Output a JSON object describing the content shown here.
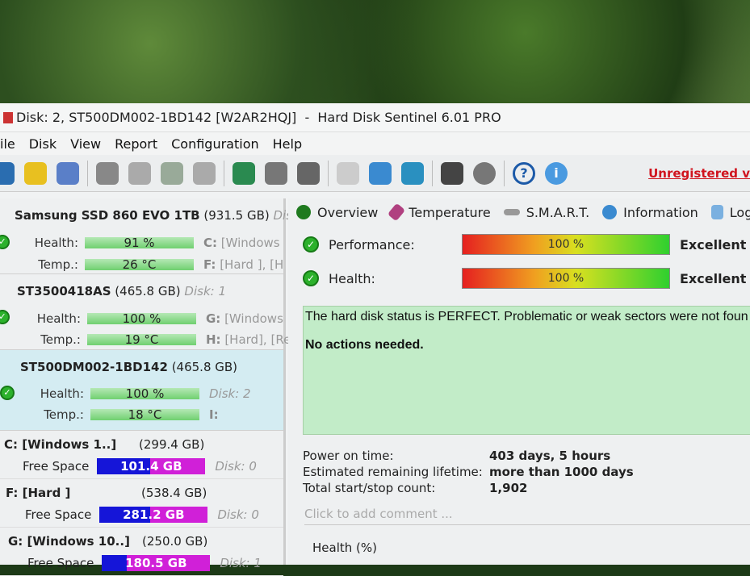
{
  "window": {
    "title": "Disk: 2, ST500DM002-1BD142 [W2AR2HQJ]  -  Hard Disk Sentinel 6.01 PRO"
  },
  "menu": [
    "ile",
    "Disk",
    "View",
    "Report",
    "Configuration",
    "Help"
  ],
  "toolbar": {
    "icons": [
      "refresh-icon",
      "alert-icon",
      "disk-icon",
      "disk-gray-icon",
      "disk-info-icon",
      "disk-check-icon",
      "disk-search-icon",
      "globe-disk-icon",
      "disk-stack-icon",
      "disk-tower-icon",
      "document-icon",
      "sync-icon",
      "network-icon",
      "laptop-tools-icon",
      "speaker-icon",
      "help-icon",
      "info-icon"
    ],
    "unregistered": "Unregistered v"
  },
  "disks": [
    {
      "name": "Samsung SSD 860 EVO 1TB",
      "size": "(931.5 GB)",
      "disk": "Disk:",
      "health": "91 %",
      "health_pct": 91,
      "temp": "26 °C",
      "vol1": "C:",
      "vol1_rest": " [Windows",
      "vol2": "F:",
      "vol2_rest": " [Hard ],  [H"
    },
    {
      "name": "ST3500418AS",
      "size": "(465.8 GB)",
      "disk": "Disk: 1",
      "health": "100 %",
      "health_pct": 100,
      "temp": "19 °C",
      "vol1": "G:",
      "vol1_rest": " [Windows",
      "vol2": "H:",
      "vol2_rest": " [Hard],  [Re"
    },
    {
      "name": "ST500DM002-1BD142",
      "size": "(465.8 GB)",
      "disk": "Disk: 2",
      "health": "100 %",
      "health_pct": 100,
      "temp": "18 °C",
      "vol2": "I:"
    }
  ],
  "labels": {
    "health": "Health:",
    "temp": "Temp.:",
    "free": "Free Space"
  },
  "volumes": [
    {
      "name": "C: [Windows 1..]",
      "size": "(299.4 GB)",
      "free": "101.4 GB",
      "used_frac": 0.49,
      "disk": "Disk: 0"
    },
    {
      "name": "F: [Hard ]",
      "size": "(538.4 GB)",
      "free": "281.2 GB",
      "used_frac": 0.47,
      "disk": "Disk: 0"
    },
    {
      "name": "G: [Windows 10..]",
      "size": "(250.0 GB)",
      "free": "180.5 GB",
      "used_frac": 0.23,
      "disk": "Disk: 1"
    }
  ],
  "tabs": [
    "Overview",
    "Temperature",
    "S.M.A.R.T.",
    "Information",
    "Log"
  ],
  "overview": {
    "performance_label": "Performance:",
    "performance": "100 %",
    "performance_pct": 100,
    "performance_rating": "Excellent",
    "health_label": "Health:",
    "health": "100 %",
    "health_pct": 100,
    "health_rating": "Excellent",
    "status_text": "The hard disk status is PERFECT. Problematic or weak sectors were not foun",
    "actions": "No actions needed.",
    "info": [
      [
        "Power on time:",
        "403 days, 5 hours"
      ],
      [
        "Estimated remaining lifetime:",
        "more than 1000 days"
      ],
      [
        "Total start/stop count:",
        "1,902"
      ]
    ],
    "comment_placeholder": "Click to add comment ...",
    "chart_title": "Health (%)"
  }
}
